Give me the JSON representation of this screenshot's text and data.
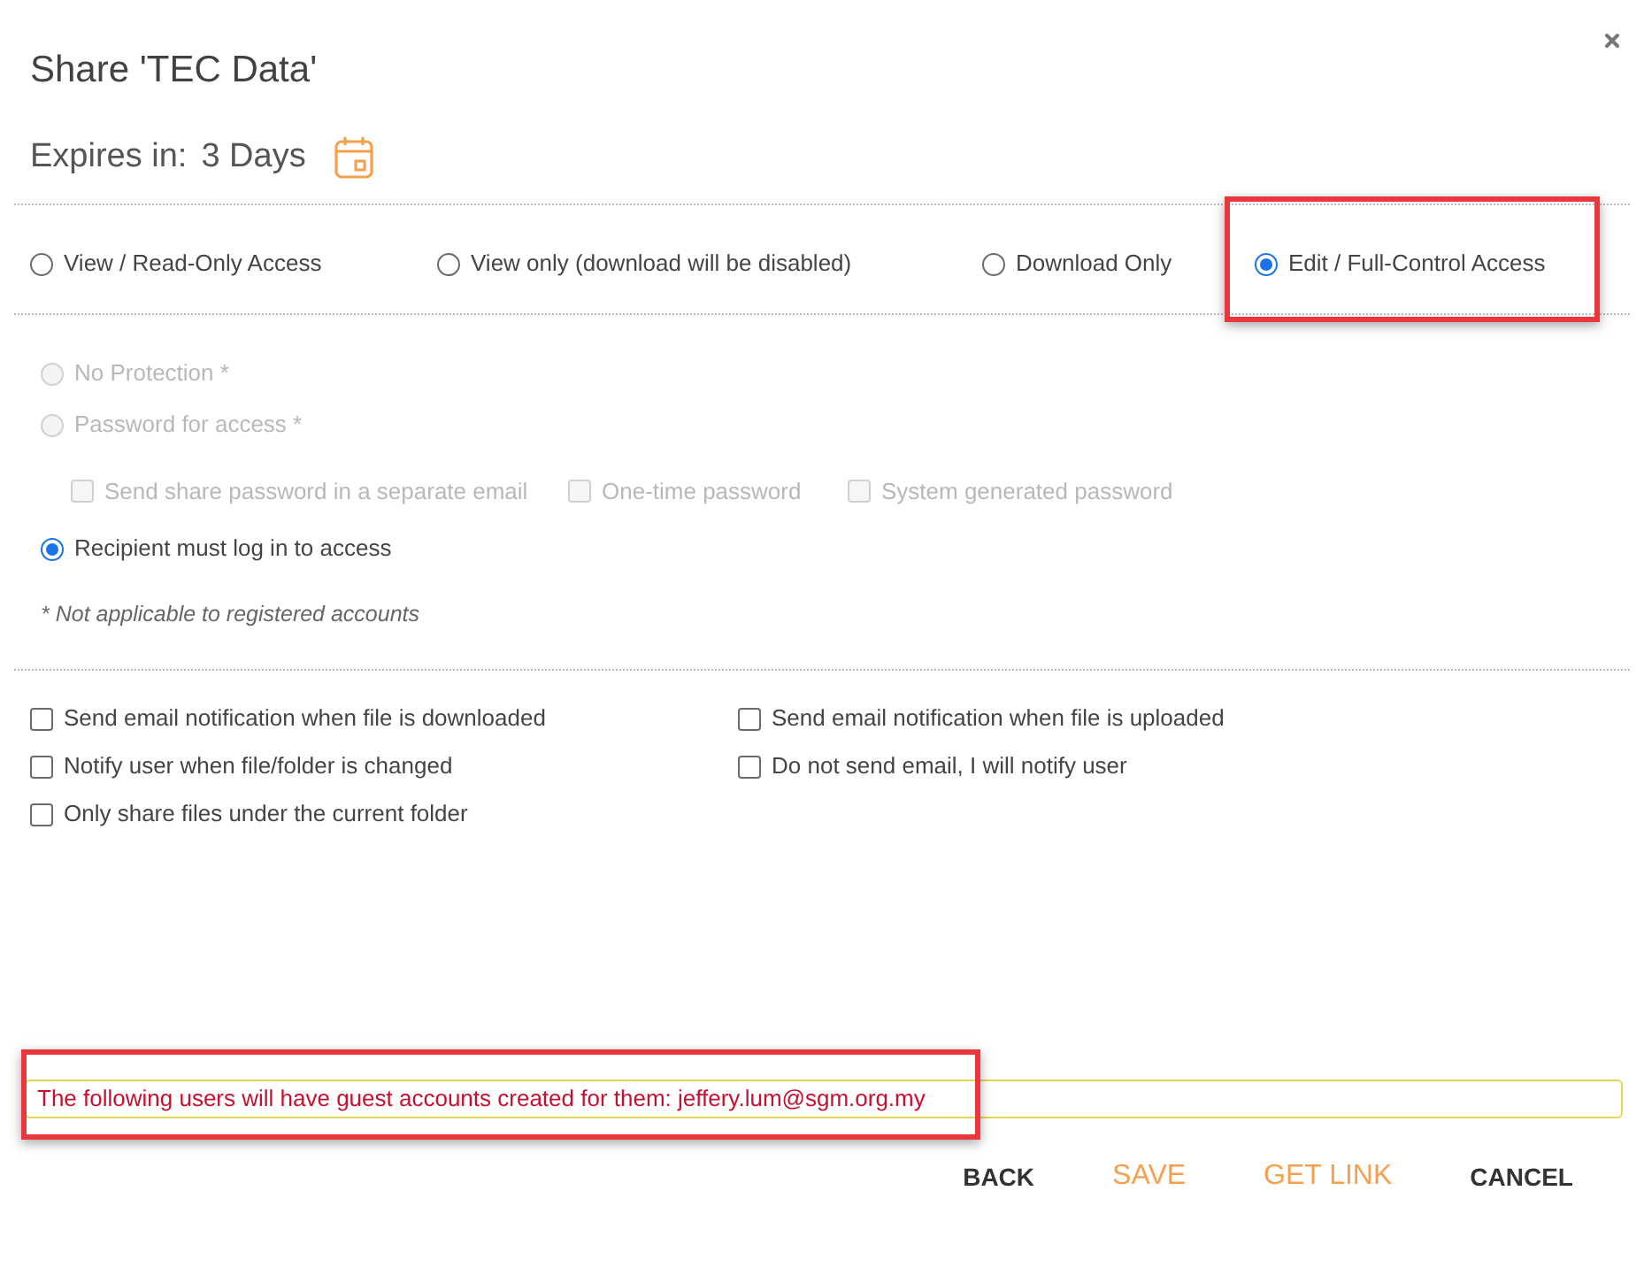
{
  "dialog": {
    "title": "Share 'TEC Data'"
  },
  "expiry": {
    "label": "Expires in:",
    "value": "3 Days"
  },
  "access_options": [
    {
      "label": "View / Read-Only Access",
      "selected": false,
      "highlighted": false
    },
    {
      "label": "View only (download will be disabled)",
      "selected": false,
      "highlighted": false
    },
    {
      "label": "Download Only",
      "selected": false,
      "highlighted": false
    },
    {
      "label": "Edit / Full-Control Access",
      "selected": true,
      "highlighted": true
    }
  ],
  "protection_options": [
    {
      "kind": "radio",
      "label": "No Protection *",
      "selected": false,
      "disabled": true
    },
    {
      "kind": "radio",
      "label": "Password for access *",
      "selected": false,
      "disabled": true
    },
    {
      "kind": "checkboxes",
      "items": [
        {
          "label": "Send share password in a separate email",
          "checked": false,
          "disabled": true
        },
        {
          "label": "One-time password",
          "checked": false,
          "disabled": true
        },
        {
          "label": "System generated password",
          "checked": false,
          "disabled": true
        }
      ]
    },
    {
      "kind": "radio",
      "label": "Recipient must log in to access",
      "selected": true,
      "disabled": false
    }
  ],
  "protection_note": "* Not applicable to registered accounts",
  "notifications": [
    {
      "label": "Send email notification when file is downloaded",
      "checked": false
    },
    {
      "label": "Send email notification when file is uploaded",
      "checked": false
    },
    {
      "label": "Notify user when file/folder is changed",
      "checked": false
    },
    {
      "label": "Do not send email, I will notify user",
      "checked": false
    },
    {
      "label": "Only share files under the current folder",
      "checked": false
    }
  ],
  "notice": {
    "text": "The following users will have guest accounts created for them: jeffery.lum@sgm.org.my",
    "highlighted": true
  },
  "buttons": [
    {
      "label": "BACK",
      "kind": "plain"
    },
    {
      "label": "SAVE",
      "kind": "accent"
    },
    {
      "label": "GET LINK",
      "kind": "accent"
    },
    {
      "label": "CANCEL",
      "kind": "plain"
    }
  ]
}
